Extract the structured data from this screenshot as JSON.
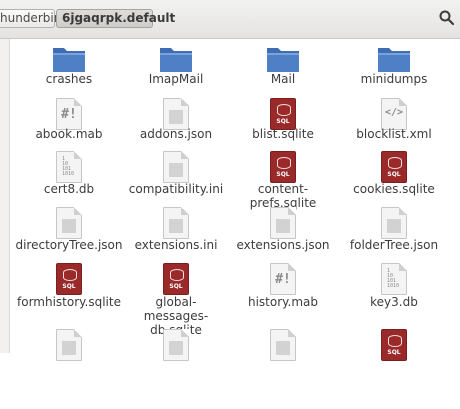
{
  "path_bar": {
    "parent": "hunderbird",
    "current": "6jgaqrpk.default"
  },
  "colors": {
    "folder": "#4f7fc4",
    "sql": "#9a2a2a"
  },
  "files": [
    {
      "name": "crashes",
      "icon": "folder-icon"
    },
    {
      "name": "ImapMail",
      "icon": "folder-icon"
    },
    {
      "name": "Mail",
      "icon": "folder-icon"
    },
    {
      "name": "minidumps",
      "icon": "folder-icon"
    },
    {
      "name": "abook.mab",
      "icon": "mab-file-icon"
    },
    {
      "name": "addons.json",
      "icon": "text-file-icon"
    },
    {
      "name": "blist.sqlite",
      "icon": "sqlite-file-icon"
    },
    {
      "name": "blocklist.xml",
      "icon": "xml-file-icon"
    },
    {
      "name": "cert8.db",
      "icon": "binary-file-icon"
    },
    {
      "name": "compatibility.ini",
      "icon": "text-file-icon"
    },
    {
      "name": "content-prefs.sqlite",
      "icon": "sqlite-file-icon"
    },
    {
      "name": "cookies.sqlite",
      "icon": "sqlite-file-icon"
    },
    {
      "name": "directoryTree.json",
      "icon": "text-file-icon"
    },
    {
      "name": "extensions.ini",
      "icon": "text-file-icon"
    },
    {
      "name": "extensions.json",
      "icon": "text-file-icon"
    },
    {
      "name": "folderTree.json",
      "icon": "text-file-icon"
    },
    {
      "name": "formhistory.sqlite",
      "icon": "sqlite-file-icon"
    },
    {
      "name": "global-messages-db.sqlite",
      "icon": "sqlite-file-icon"
    },
    {
      "name": "history.mab",
      "icon": "mab-file-icon"
    },
    {
      "name": "key3.db",
      "icon": "binary-file-icon"
    },
    {
      "name": "",
      "icon": "text-file-icon"
    },
    {
      "name": "",
      "icon": "text-file-icon"
    },
    {
      "name": "",
      "icon": "text-file-icon"
    },
    {
      "name": "",
      "icon": "sqlite-file-icon"
    }
  ]
}
